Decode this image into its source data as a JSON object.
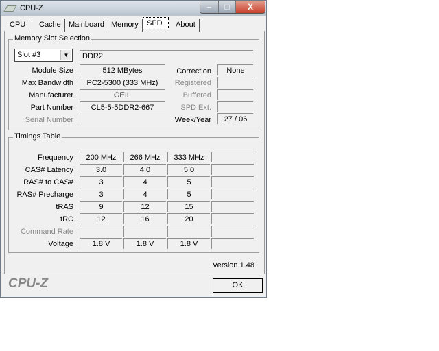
{
  "window": {
    "title": "CPU-Z",
    "minimize": "–",
    "maximize": "□",
    "close": "X"
  },
  "tabs": [
    "CPU",
    "Cache",
    "Mainboard",
    "Memory",
    "SPD",
    "About"
  ],
  "slot": {
    "group_label": "Memory Slot Selection",
    "selected": "Slot #3",
    "type": "DDR2",
    "module_size_label": "Module Size",
    "module_size": "512 MBytes",
    "max_bw_label": "Max Bandwidth",
    "max_bw": "PC2-5300 (333 MHz)",
    "manufacturer_label": "Manufacturer",
    "manufacturer": "GEIL",
    "part_label": "Part Number",
    "part": "CL5-5-5DDR2-667",
    "serial_label": "Serial Number",
    "serial": "",
    "correction_label": "Correction",
    "correction": "None",
    "registered_label": "Registered",
    "buffered_label": "Buffered",
    "spdext_label": "SPD Ext.",
    "weekyear_label": "Week/Year",
    "weekyear": "27 / 06"
  },
  "timings": {
    "group_label": "Timings Table",
    "rows": [
      {
        "label": "Frequency",
        "values": [
          "200 MHz",
          "266 MHz",
          "333 MHz",
          ""
        ]
      },
      {
        "label": "CAS# Latency",
        "values": [
          "3.0",
          "4.0",
          "5.0",
          ""
        ]
      },
      {
        "label": "RAS# to CAS#",
        "values": [
          "3",
          "4",
          "5",
          ""
        ]
      },
      {
        "label": "RAS# Precharge",
        "values": [
          "3",
          "4",
          "5",
          ""
        ]
      },
      {
        "label": "tRAS",
        "values": [
          "9",
          "12",
          "15",
          ""
        ]
      },
      {
        "label": "tRC",
        "values": [
          "12",
          "16",
          "20",
          ""
        ]
      },
      {
        "label": "Command Rate",
        "values": [
          "",
          "",
          "",
          ""
        ],
        "disabled": true
      },
      {
        "label": "Voltage",
        "values": [
          "1.8 V",
          "1.8 V",
          "1.8 V",
          ""
        ]
      }
    ]
  },
  "footer": {
    "version": "Version 1.48",
    "logo": "CPU-Z",
    "ok": "OK"
  }
}
